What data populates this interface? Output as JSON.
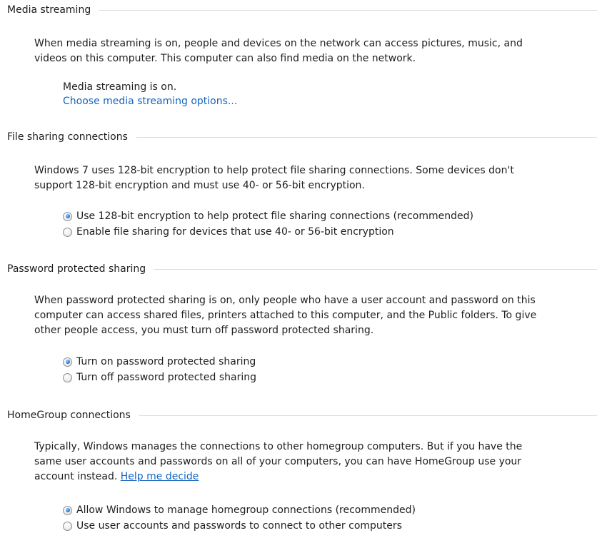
{
  "colors": {
    "text": "#1e1e1e",
    "link": "#1565c0",
    "divider": "#dcdcdc",
    "radio_selected": "#2b7fd9"
  },
  "media_streaming": {
    "title": "Media streaming",
    "description": [
      "When media streaming is on, people and devices on the network can access pictures, music, and",
      "videos on this computer. This computer can also find media on the network."
    ],
    "status": "Media streaming is on.",
    "options_link": "Choose media streaming options..."
  },
  "file_sharing": {
    "title": "File sharing connections",
    "description": [
      "Windows 7 uses 128-bit encryption to help protect file sharing connections. Some devices don't",
      "support 128-bit encryption and must use 40- or 56-bit encryption."
    ],
    "options": [
      {
        "label": "Use 128-bit encryption to help protect file sharing connections (recommended)",
        "selected": true
      },
      {
        "label": "Enable file sharing for devices that use 40- or 56-bit encryption",
        "selected": false
      }
    ]
  },
  "password_sharing": {
    "title": "Password protected sharing",
    "description": [
      "When password protected sharing is on, only people who have a user account and password on this",
      "computer can access shared files, printers attached to this computer, and the Public folders. To give",
      "other people access, you must turn off password protected sharing."
    ],
    "options": [
      {
        "label": "Turn on password protected sharing",
        "selected": true
      },
      {
        "label": "Turn off password protected sharing",
        "selected": false
      }
    ]
  },
  "homegroup": {
    "title": "HomeGroup connections",
    "description": [
      "Typically, Windows manages the connections to other homegroup computers. But if you have the",
      "same user accounts and passwords on all of your computers, you can have HomeGroup use your",
      "account instead."
    ],
    "help_link": "Help me decide",
    "options": [
      {
        "label": "Allow Windows to manage homegroup connections (recommended)",
        "selected": true
      },
      {
        "label": "Use user accounts and passwords to connect to other computers",
        "selected": false
      }
    ]
  }
}
